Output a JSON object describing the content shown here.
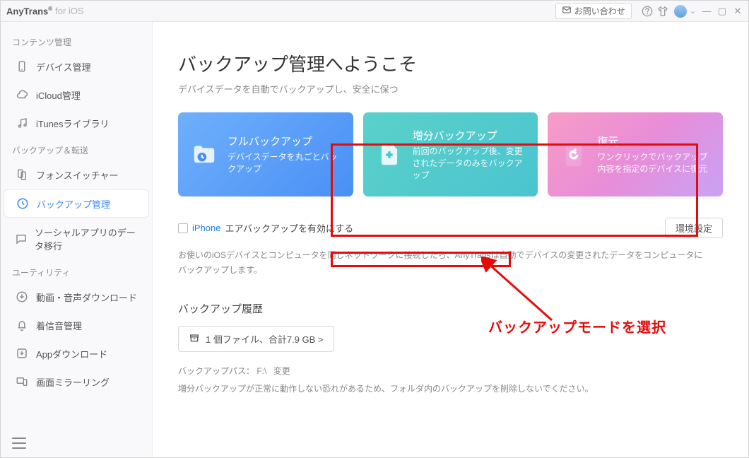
{
  "titlebar": {
    "brand": "AnyTrans",
    "reg": "®",
    "sub": "for iOS",
    "contact_label": "お問い合わせ"
  },
  "sidebar": {
    "sections": {
      "content": "コンテンツ管理",
      "backup": "バックアップ＆転送",
      "utility": "ユーティリティ"
    },
    "items": {
      "device": "デバイス管理",
      "icloud": "iCloud管理",
      "itunes": "iTunesライブラリ",
      "phone_switcher": "フォンスイッチャー",
      "backup_mgmt": "バックアップ管理",
      "social": "ソーシャルアプリのデータ移行",
      "media_dl": "動画・音声ダウンロード",
      "ringtone": "着信音管理",
      "app_dl": "Appダウンロード",
      "mirror": "画面ミラーリング"
    }
  },
  "main": {
    "title": "バックアップ管理へようこそ",
    "subtitle": "デバイスデータを自動でバックアップし、安全に保つ"
  },
  "cards": [
    {
      "title": "フルバックアップ",
      "sub": "デバイスデータを丸ごとバックアップ"
    },
    {
      "title": "増分バックアップ",
      "sub": "前回のバックアップ後、変更されたデータのみをバックアップ"
    },
    {
      "title": "復元",
      "sub": "ワンクリックでバックアップ内容を指定のデバイスに復元"
    }
  ],
  "airbackup": {
    "device": "iPhone",
    "label": "エアバックアップを有効にする",
    "env_button": "環境設定",
    "desc1": "お使いのiOSデバイスとコンピュータを同じネットワークに接続したら、AnyTransは自動でデバイスの変更されたデータをコンピュータに",
    "desc2": "バックアップします。"
  },
  "history": {
    "title": "バックアップ履歴",
    "button": "1 個ファイル、合計7.9 GB >",
    "path_label": "バックアップパス： F:\\",
    "change": "変更",
    "note": "増分バックアップが正常に動作しない恐れがあるため、フォルダ内のバックアップを削除しないでください。"
  },
  "annotation": {
    "text": "バックアップモードを選択"
  }
}
